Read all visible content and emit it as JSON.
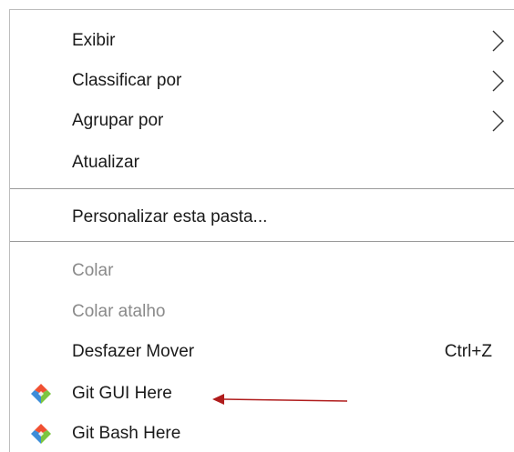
{
  "menu": {
    "items": [
      {
        "label": "Exibir",
        "submenu": true
      },
      {
        "label": "Classificar por",
        "submenu": true
      },
      {
        "label": "Agrupar por",
        "submenu": true
      },
      {
        "label": "Atualizar"
      },
      {
        "label": "Personalizar esta pasta..."
      },
      {
        "label": "Colar",
        "disabled": true
      },
      {
        "label": "Colar atalho",
        "disabled": true
      },
      {
        "label": "Desfazer Mover",
        "shortcut": "Ctrl+Z"
      },
      {
        "label": "Git GUI Here",
        "icon": "git-gui-icon"
      },
      {
        "label": "Git Bash Here",
        "icon": "git-bash-icon"
      }
    ]
  },
  "colors": {
    "text": "#1a1a1a",
    "disabled_text": "#8a8a8a",
    "separator": "#9a9a9a",
    "annotation_arrow": "#b01c1c"
  }
}
